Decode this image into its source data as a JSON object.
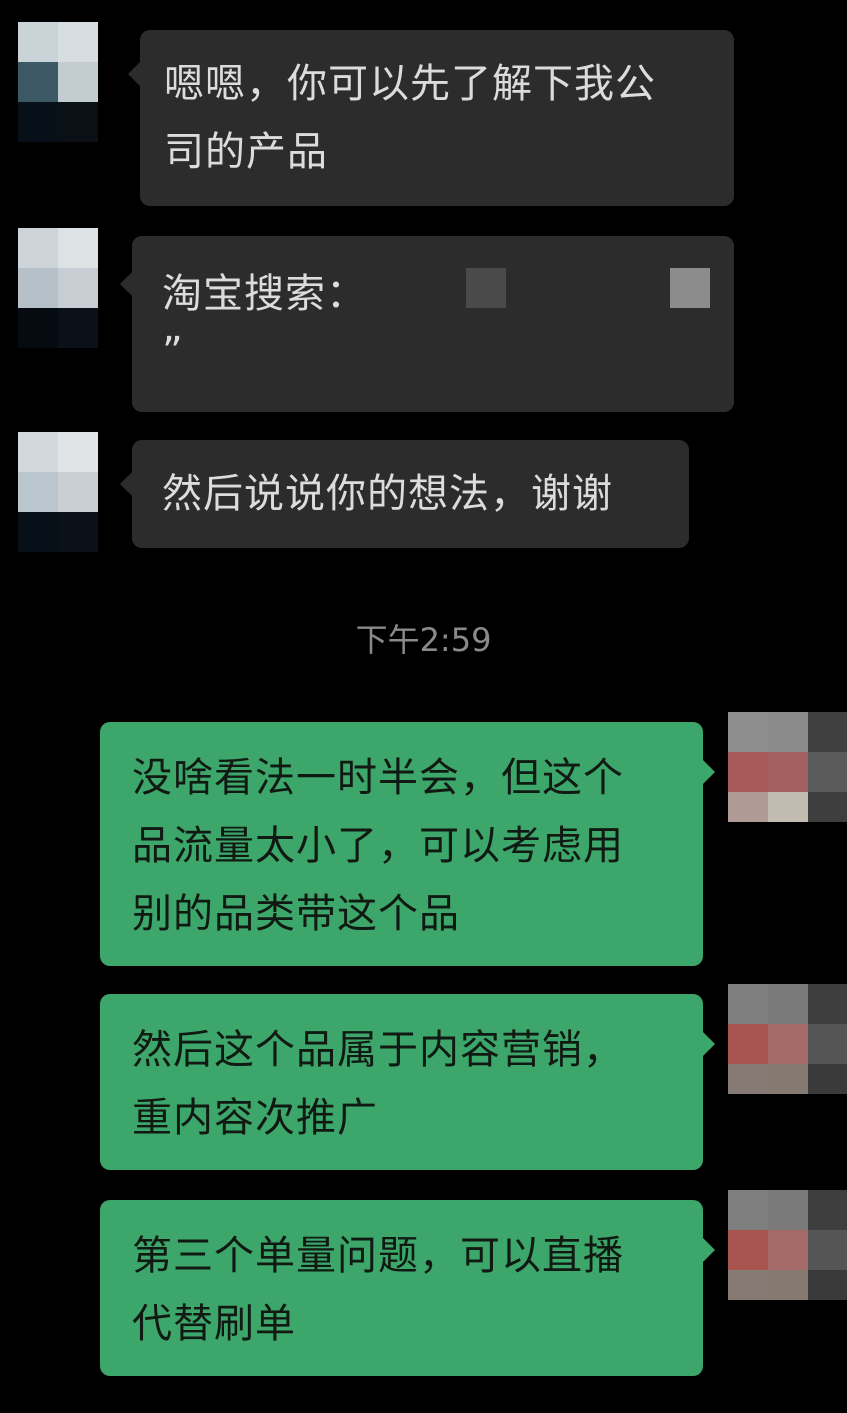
{
  "timestamp": "下午2:59",
  "messages": [
    {
      "direction": "in",
      "lines": [
        "嗯嗯，你可以先了解下我公",
        "司的产品"
      ]
    },
    {
      "direction": "in",
      "lines": [
        "淘宝搜索："
      ],
      "trailing": "”",
      "redacted": true
    },
    {
      "direction": "in",
      "lines": [
        "然后说说你的想法，谢谢"
      ]
    },
    {
      "direction": "out",
      "lines": [
        "没啥看法一时半会，但这个",
        "品流量太小了，可以考虑用",
        "别的品类带这个品"
      ]
    },
    {
      "direction": "out",
      "lines": [
        "然后这个品属于内容营销，",
        "重内容次推广"
      ]
    },
    {
      "direction": "out",
      "lines": [
        "第三个单量问题，可以直播",
        "代替刷单"
      ]
    }
  ],
  "colors": {
    "background": "#000000",
    "incoming_bubble": "#2c2c2c",
    "outgoing_bubble": "#3ca66b",
    "timestamp_text": "#8a8a8a"
  },
  "icons": {
    "contact_avatar": "pixelated-avatar-icon",
    "self_avatar": "pixelated-avatar-icon"
  }
}
